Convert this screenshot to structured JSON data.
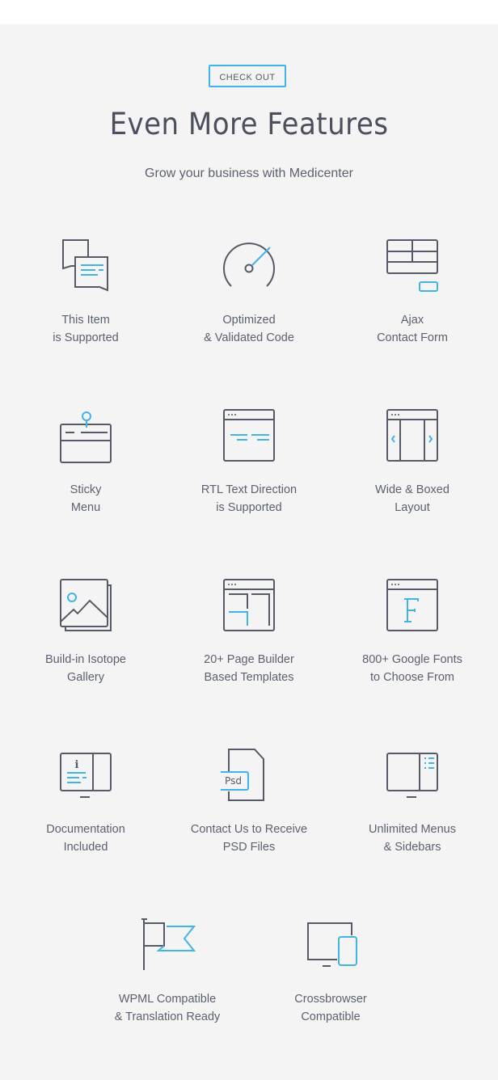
{
  "header": {
    "badge_label": "CHECK OUT",
    "title": "Even More Features",
    "subtitle": "Grow your business with Medicenter"
  },
  "colors": {
    "accent": "#42b3e5",
    "icon_stroke": "#555a66",
    "background": "#f4f4f4",
    "text": "#5c6170"
  },
  "features": [
    {
      "icon": "chat-bubbles-icon",
      "line1": "This Item",
      "line2": "is Supported"
    },
    {
      "icon": "speedometer-icon",
      "line1": "Optimized",
      "line2": "& Validated Code"
    },
    {
      "icon": "contact-form-icon",
      "line1": "Ajax",
      "line2": "Contact Form"
    },
    {
      "icon": "sticky-menu-icon",
      "line1": "Sticky",
      "line2": "Menu"
    },
    {
      "icon": "rtl-text-icon",
      "line1": "RTL Text Direction",
      "line2": "is Supported"
    },
    {
      "icon": "wide-boxed-layout-icon",
      "line1": "Wide & Boxed",
      "line2": "Layout"
    },
    {
      "icon": "gallery-image-icon",
      "line1": "Build-in Isotope",
      "line2": "Gallery"
    },
    {
      "icon": "page-builder-icon",
      "line1": "20+ Page Builder",
      "line2": "Based Templates"
    },
    {
      "icon": "google-fonts-icon",
      "line1": "800+ Google Fonts",
      "line2": "to Choose From"
    },
    {
      "icon": "documentation-icon",
      "line1": "Documentation",
      "line2": "Included"
    },
    {
      "icon": "psd-file-icon",
      "line1": "Contact Us to Receive",
      "line2": "PSD Files",
      "icon_text": "Psd"
    },
    {
      "icon": "menus-sidebars-icon",
      "line1": "Unlimited Menus",
      "line2": "& Sidebars"
    },
    {
      "icon": "wpml-flag-icon",
      "line1": "WPML Compatible",
      "line2": "& Translation Ready"
    },
    {
      "icon": "crossbrowser-devices-icon",
      "line1": "Crossbrowser",
      "line2": "Compatible"
    }
  ],
  "doc_icon_letter": "i"
}
